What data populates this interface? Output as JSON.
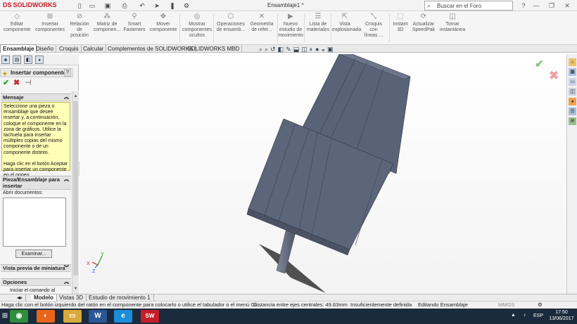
{
  "titlebar": {
    "app": "SOLIDWORKS",
    "logo_mark": "DS",
    "document_title": "Ensamblaje1 *",
    "search_placeholder": "Buscar en el Foro",
    "quick_access": [
      "new-icon",
      "open-icon",
      "save-icon",
      "print-icon",
      "undo-icon",
      "select-icon",
      "rebuild-icon",
      "options-icon"
    ]
  },
  "ribbon": {
    "buttons": [
      {
        "label": "Editar componente",
        "icon": "edit-component-icon"
      },
      {
        "label": "Insertar componentes",
        "icon": "insert-components-icon"
      },
      {
        "label": "Relación de posición",
        "icon": "mate-icon"
      },
      {
        "label": "Matriz de componen...",
        "icon": "component-pattern-icon"
      },
      {
        "label": "Smart Fasteners",
        "icon": "smart-fasteners-icon"
      },
      {
        "label": "Mover componente",
        "icon": "move-component-icon"
      },
      {
        "label": "Mostrar componentes ocultos",
        "icon": "show-hidden-icon"
      },
      {
        "label": "Operaciones de ensamb...",
        "icon": "assembly-features-icon"
      },
      {
        "label": "Geometría de refer...",
        "icon": "reference-geometry-icon"
      },
      {
        "label": "Nuevo estudio de movimiento",
        "icon": "motion-study-icon"
      },
      {
        "label": "Lista de materiales",
        "icon": "bom-icon"
      },
      {
        "label": "Vista explosionada",
        "icon": "exploded-view-icon"
      },
      {
        "label": "Croquis con líneas ...",
        "icon": "explode-line-icon"
      },
      {
        "label": "Instant 3D",
        "icon": "instant3d-icon"
      },
      {
        "label": "Actualizar SpeedPak",
        "icon": "speedpak-icon"
      },
      {
        "label": "Tomar instantánea",
        "icon": "snapshot-icon"
      }
    ]
  },
  "command_tabs": [
    "Ensamblaje",
    "Diseño",
    "Croquis",
    "Calcular",
    "Complementos de SOLIDWORKS",
    "SOLIDWORKS MBD"
  ],
  "property_manager": {
    "title": "Insertar componente",
    "help": "?",
    "actions": {
      "ok": "✔",
      "cancel": "✖",
      "pin": "⊣"
    },
    "message_section": "Mensaje",
    "message_text": "Seleccione una pieza o ensamblaje que desee insertar y, a continuación, coloque el componente en la zona de gráficos. Utilice la tachuela para insertar múltiples copias del mismo componente o de un componente distinto.\n\nHaga clic en el botón Aceptar para insertar un componente en el origen.",
    "part_section": "Pieza/Ensamblaje para insertar",
    "open_docs_label": "Abrir documentos:",
    "explore_button": "Examinar...",
    "thumbnail_section": "Vista previa de miniatura",
    "options_section": "Opciones",
    "options_item": "Iniciar el comando al"
  },
  "viewport": {
    "confirm_corner": {
      "ok": "✔",
      "cancel": "✖"
    },
    "triad": {
      "x": "X",
      "y": "Y",
      "z": "Z"
    }
  },
  "bottom_tabs": [
    "Modelo",
    "Vistas 3D",
    "Estudio de movimiento 1"
  ],
  "status_bar": {
    "hint": "Haga clic con el botón izquierdo del ratón en el componente para colocarlo o utilice el tabulador o el menú Gi...",
    "distance": "Distancia entre ejes centrales: 49.63mm",
    "definition": "Insuficientemente definida",
    "mode": "Editando Ensamblaje",
    "units": "MMGS"
  },
  "taskbar": {
    "apps": [
      {
        "name": "chrome",
        "label": "◉",
        "color": "#2f8f3a"
      },
      {
        "name": "firefox",
        "label": "◐",
        "color": "#e8651a"
      },
      {
        "name": "explorer",
        "label": "▭",
        "color": "#d9a93b"
      },
      {
        "name": "word",
        "label": "W",
        "color": "#2b5797"
      },
      {
        "name": "ie",
        "label": "e",
        "color": "#1a8ed9"
      },
      {
        "name": "solidworks",
        "label": "SW",
        "color": "#c41e2a"
      }
    ],
    "lang": "ESP",
    "time": "17:50",
    "date": "13/06/2017"
  },
  "colors": {
    "accent": "#1a6fc0",
    "message_bg": "#ffffb8",
    "model": "#566076"
  }
}
